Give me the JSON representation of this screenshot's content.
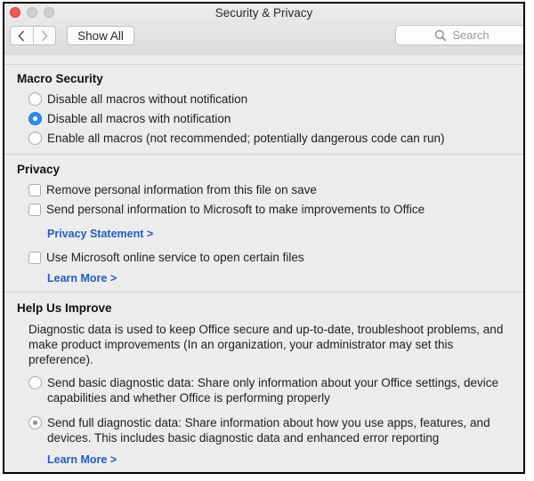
{
  "window": {
    "title": "Security & Privacy"
  },
  "toolbar": {
    "show_all_label": "Show All",
    "search_placeholder": "Search"
  },
  "macro_security": {
    "title": "Macro Security",
    "options": [
      {
        "label": "Disable all macros without notification",
        "selected": false
      },
      {
        "label": "Disable all macros with notification",
        "selected": true
      },
      {
        "label": "Enable all macros (not recommended; potentially dangerous code can run)",
        "selected": false
      }
    ]
  },
  "privacy": {
    "title": "Privacy",
    "remove_personal_info": "Remove personal information from this file on save",
    "send_personal_info": "Send personal information to Microsoft to make improvements to Office",
    "privacy_statement_link": "Privacy Statement >",
    "use_online_service": "Use Microsoft online service to open certain files",
    "learn_more_link": "Learn More >"
  },
  "help_us_improve": {
    "title": "Help Us Improve",
    "description": "Diagnostic data is used to keep Office secure and up-to-date, troubleshoot problems, and make product improvements (In an organization, your administrator may set this preference).",
    "basic_option": "Send basic diagnostic data: Share only information about your Office settings, device capabilities and whether Office is performing properly",
    "full_option": "Send full diagnostic data: Share information about how you use apps, features, and devices. This includes basic diagnostic data and enhanced error reporting",
    "learn_more_link": "Learn More >"
  },
  "colors": {
    "accent": "#2c8bf2",
    "link": "#1f5fc4",
    "close_button": "#ee5a52"
  }
}
